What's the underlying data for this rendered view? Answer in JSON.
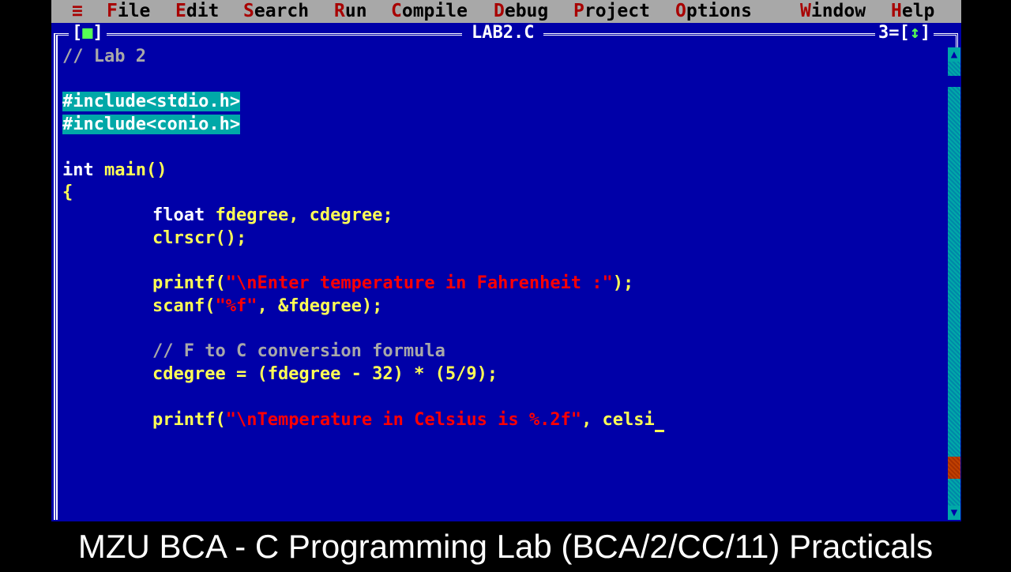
{
  "menubar": {
    "system_icon": "≡",
    "items": [
      {
        "hot": "F",
        "rest": "ile"
      },
      {
        "hot": "E",
        "rest": "dit"
      },
      {
        "hot": "S",
        "rest": "earch"
      },
      {
        "hot": "R",
        "rest": "un"
      },
      {
        "hot": "C",
        "rest": "ompile"
      },
      {
        "hot": "D",
        "rest": "ebug"
      },
      {
        "hot": "P",
        "rest": "roject"
      },
      {
        "hot": "O",
        "rest": "ptions"
      },
      {
        "hot": "W",
        "rest": "indow"
      },
      {
        "hot": "H",
        "rest": "elp"
      }
    ]
  },
  "window": {
    "close_box_left": "[",
    "close_box_mark": "■",
    "close_box_right": "]",
    "title": "LAB2.C",
    "number": "3",
    "zoom_left": "[",
    "zoom_mark": "↕",
    "zoom_right": "]"
  },
  "code": {
    "line1_comment": "// Lab 2",
    "line3_include": "#include<stdio.h>",
    "line4_include": "#include<conio.h>",
    "line6_int": "int",
    "line6_rest": " main()",
    "line7": "{",
    "line8_kw": "float",
    "line8_rest": " fdegree, cdegree;",
    "line9": "clrscr();",
    "line11_a": "printf(",
    "line11_str": "\"\\nEnter temperature in Fahrenheit :\"",
    "line11_b": ");",
    "line12_a": "scanf(",
    "line12_str": "\"%f\"",
    "line12_b": ", &fdegree);",
    "line14_comment": "// F to C conversion formula",
    "line15": "cdegree = (fdegree - 32) * (5/9);",
    "line17_a": "printf(",
    "line17_str": "\"\\nTemperature in Celsius is %.2f\"",
    "line17_b": ", celsi"
  },
  "scrollbar": {
    "up_arrow": "▲",
    "down_arrow": "▼"
  },
  "caption": "MZU BCA - C Programming Lab (BCA/2/CC/11) Practicals",
  "colors": {
    "editor_bg": "#0000a8",
    "menubar_bg": "#a8a8a8",
    "hotkey": "#a80000",
    "code_text": "#ffff55",
    "string": "#ff0000",
    "comment": "#a8a8a8",
    "preprocessor_highlight": "#00a8a8"
  }
}
